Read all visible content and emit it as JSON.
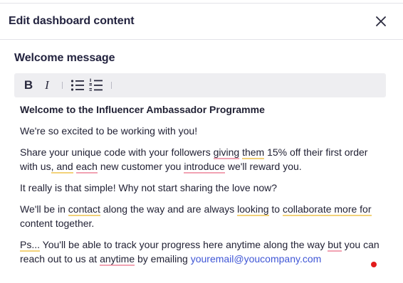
{
  "modal": {
    "title": "Edit dashboard content",
    "close_icon": "close-icon"
  },
  "field": {
    "label": "Welcome message"
  },
  "toolbar": {
    "bold_label": "B",
    "italic_label": "I",
    "icons": [
      "bold-icon",
      "italic-icon",
      "bulleted-list-icon",
      "numbered-list-icon"
    ]
  },
  "content": {
    "heading": "Welcome to the Influencer Ambassador Programme",
    "p1": "We're so excited to be working with you!",
    "p2": {
      "a": "Share your unique code with your followers ",
      "b": "giving",
      "c": " ",
      "d": "them",
      "e": " 15% off their first order with us",
      "f": ", and",
      "g": " ",
      "h": "each",
      "i": " new customer you ",
      "j": "introduce",
      "k": " we'll reward you."
    },
    "p3": "It really is that simple! Why not start sharing the love now?",
    "p4": {
      "a": "We'll be in ",
      "b": "contact",
      "c": " along the way and are always ",
      "d": "looking",
      "e": " to ",
      "f": "collaborate more for",
      "g": " content together."
    },
    "p5": {
      "a": "Ps...",
      "b": " You'll be able to track your progress here anytime along the way ",
      "c": "but",
      "d": " you can reach out to us at ",
      "e": "anytime",
      "f": " by emailing ",
      "email": "youremail@youcompany.com"
    }
  },
  "colors": {
    "spell_error": "#f2a3b3",
    "grammar_hint": "#f3d27a",
    "link": "#3f56d6",
    "indicator": "#e21b1b"
  }
}
